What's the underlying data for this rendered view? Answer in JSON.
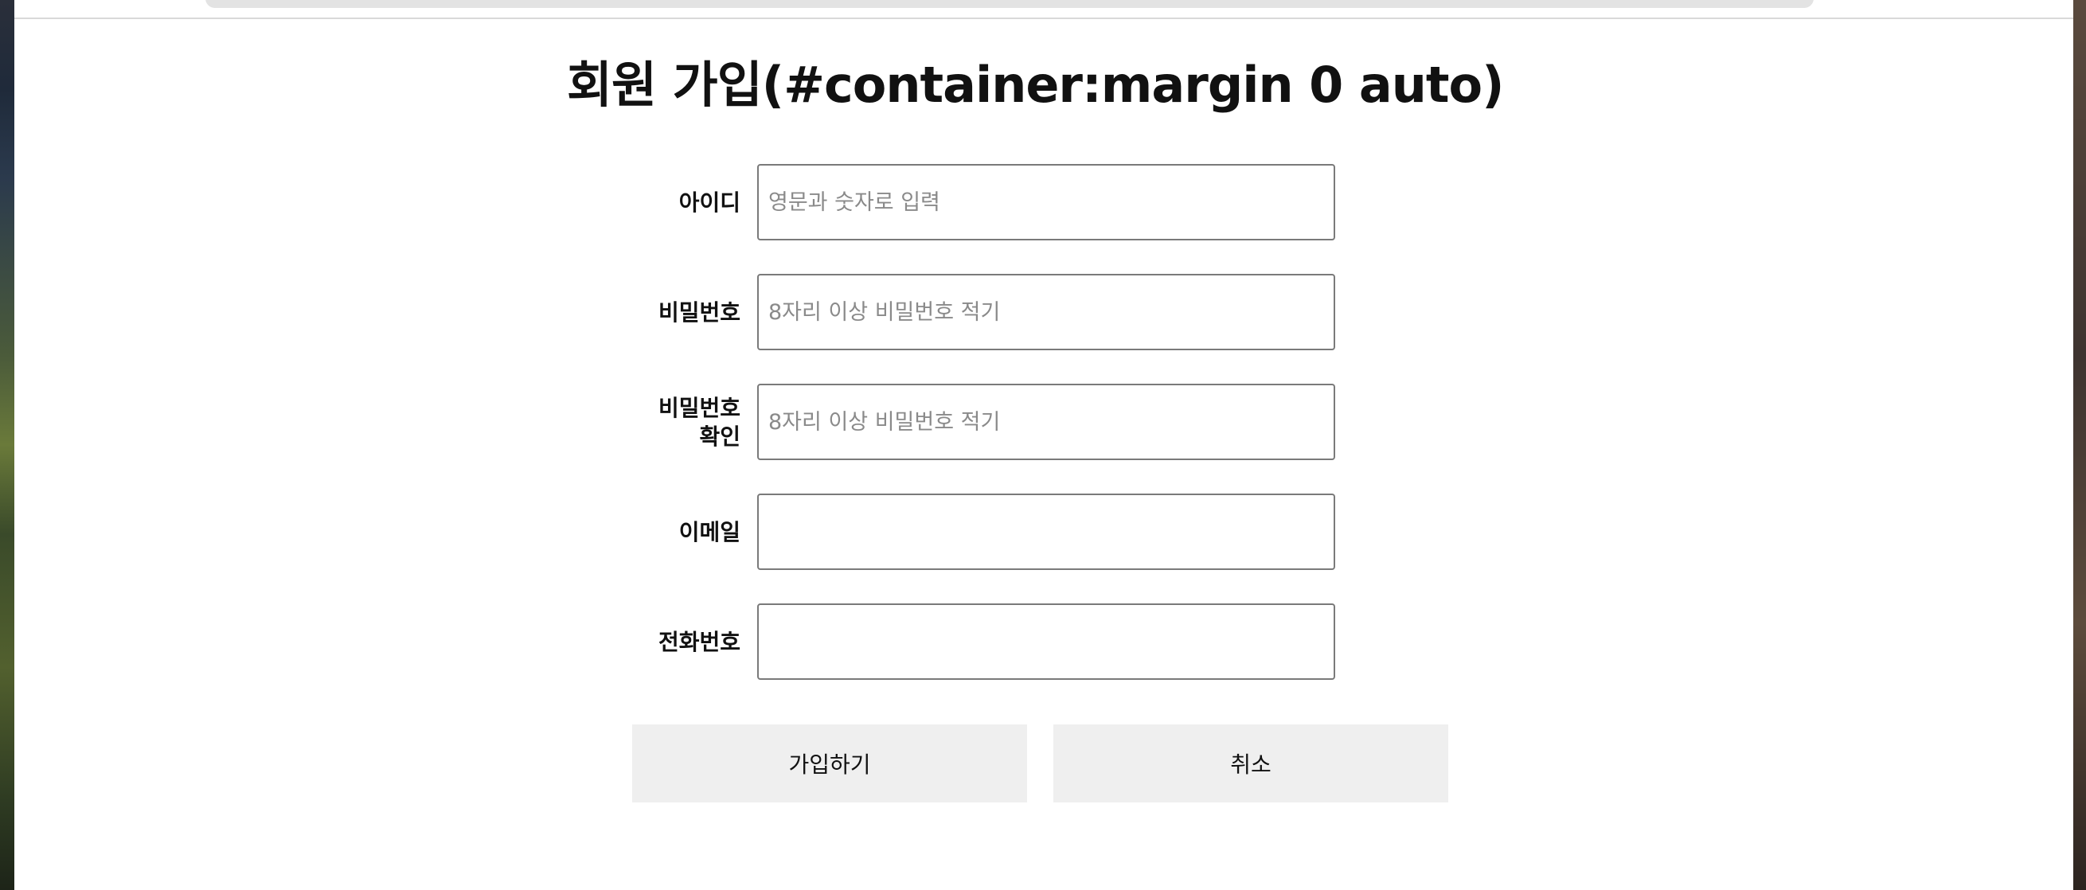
{
  "page": {
    "title": "회원 가입(#container:margin 0 auto)"
  },
  "form": {
    "fields": [
      {
        "label": "아이디",
        "placeholder": "영문과 숫자로 입력",
        "value": ""
      },
      {
        "label": "비밀번호",
        "placeholder": "8자리 이상 비밀번호 적기",
        "value": ""
      },
      {
        "label": "비밀번호\n확인",
        "placeholder": "8자리 이상 비밀번호 적기",
        "value": ""
      },
      {
        "label": "이메일",
        "placeholder": "",
        "value": ""
      },
      {
        "label": "전화번호",
        "placeholder": "",
        "value": ""
      }
    ],
    "submit_label": "가입하기",
    "cancel_label": "취소"
  }
}
